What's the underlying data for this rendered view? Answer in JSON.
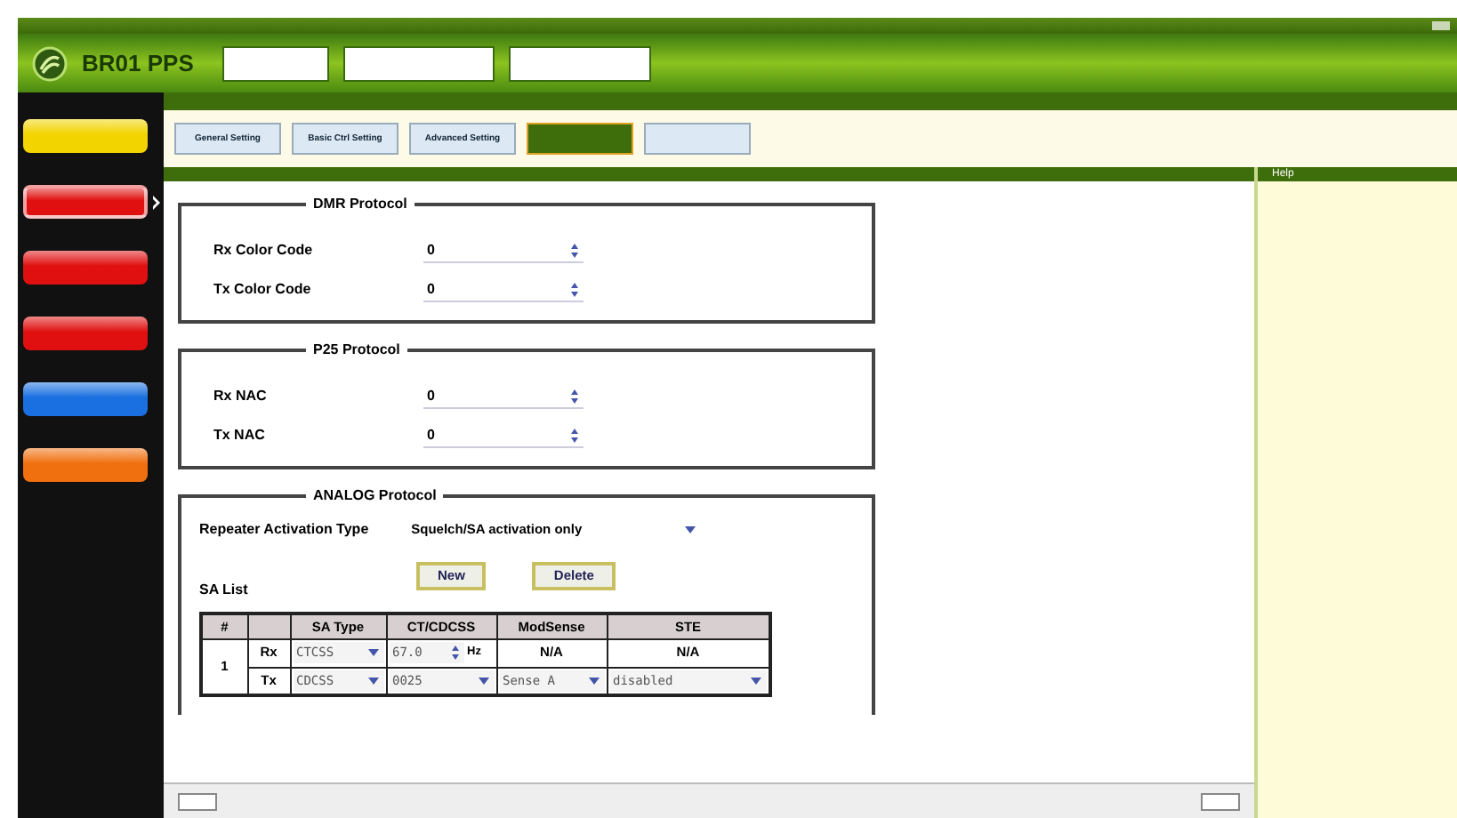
{
  "app": {
    "name": "BR01 PPS"
  },
  "sidebar": {
    "items": [
      {
        "color": "#f2d400",
        "selected": false
      },
      {
        "color": "#e01010",
        "selected": true
      },
      {
        "color": "#e01010",
        "selected": false
      },
      {
        "color": "#e01010",
        "selected": false
      },
      {
        "color": "#1a70e0",
        "selected": false
      },
      {
        "color": "#f07010",
        "selected": false
      }
    ]
  },
  "tabs": [
    {
      "label": "General Setting",
      "selected": false
    },
    {
      "label": "Basic Ctrl Setting",
      "selected": false
    },
    {
      "label": "Advanced Setting",
      "selected": false
    },
    {
      "selected": true
    },
    {
      "selected": false
    }
  ],
  "groups": [
    {
      "title": "DMR Protocol",
      "fields": [
        {
          "label": "Rx Color Code",
          "value": "0"
        },
        {
          "label": "Tx Color Code",
          "value": "0"
        }
      ]
    },
    {
      "title": "P25 Protocol",
      "fields": [
        {
          "label": "Rx NAC",
          "value": "0"
        },
        {
          "label": "Tx NAC",
          "value": "0"
        }
      ]
    }
  ],
  "analog": {
    "title": "ANALOG Protocol",
    "activation_label": "Repeater Activation Type",
    "activation_value": "Squelch/SA activation only",
    "list_label": "SA List",
    "buttons": [
      "New",
      "Delete"
    ],
    "columns": [
      "#",
      "SA Type",
      "CT/CDCSS",
      "ModSense",
      "STE"
    ],
    "entry": {
      "index": "1",
      "rx": {
        "label": "Rx",
        "sa_type": "CTCSS",
        "code": "67.0",
        "unit": "Hz",
        "mod_sense": "N/A",
        "ste": "N/A"
      },
      "tx": {
        "label": "Tx",
        "sa_type": "CDCSS",
        "code": "0025",
        "mod_sense": "Sense A",
        "ste": "disabled"
      }
    }
  },
  "help": {
    "title": "Help"
  }
}
